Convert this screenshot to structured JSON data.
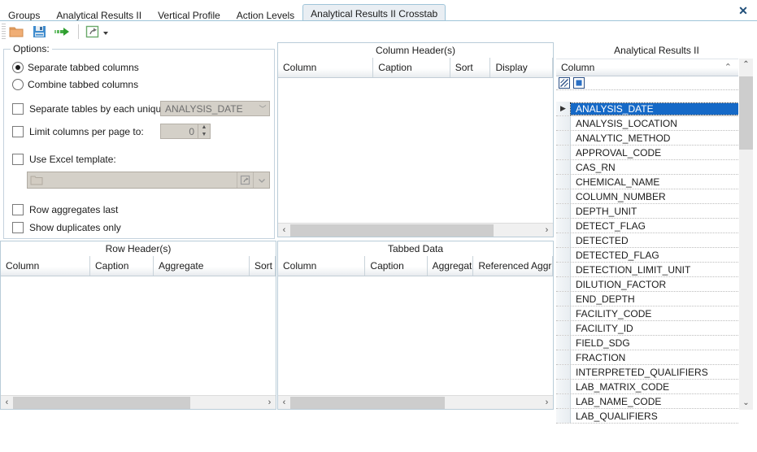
{
  "window": {
    "close_label": "✕"
  },
  "tabs": [
    {
      "label": "Groups",
      "active": false
    },
    {
      "label": "Analytical Results II",
      "active": false
    },
    {
      "label": "Vertical Profile",
      "active": false
    },
    {
      "label": "Action Levels",
      "active": false
    },
    {
      "label": "Analytical Results II Crosstab",
      "active": true
    }
  ],
  "toolbar": {
    "buttons": [
      {
        "name": "open-icon",
        "title": "Open"
      },
      {
        "name": "save-icon",
        "title": "Save"
      },
      {
        "name": "run-arrow-icon",
        "title": "Run"
      },
      {
        "name": "export-icon",
        "title": "Export"
      },
      {
        "name": "export-dropdown-icon",
        "title": "Export options"
      }
    ]
  },
  "options": {
    "group_title": "Options:",
    "radio_separate": "Separate tabbed columns",
    "radio_combine": "Combine tabbed columns",
    "radio_selected": "separate",
    "chk_separate_tables": "Separate tables by each unique:",
    "separate_tables_value": "ANALYSIS_DATE",
    "chk_limit_columns": "Limit columns per page to:",
    "limit_columns_value": "0",
    "chk_excel_template": "Use Excel template:",
    "excel_template_value": "",
    "chk_row_aggregates": "Row aggregates last",
    "chk_show_duplicates": "Show duplicates only"
  },
  "column_headers_panel": {
    "title": "Column Header(s)",
    "columns": [
      "Column",
      "Caption",
      "Sort",
      "Display"
    ],
    "rows": []
  },
  "row_headers_panel": {
    "title": "Row Header(s)",
    "columns": [
      "Column",
      "Caption",
      "Aggregate",
      "Sort"
    ],
    "rows": []
  },
  "tabbed_data_panel": {
    "title": "Tabbed Data",
    "columns": [
      "Column",
      "Caption",
      "Aggregate",
      "Referenced Aggre"
    ],
    "rows": []
  },
  "results_panel": {
    "title": "Analytical Results II",
    "column_header": "Column",
    "sort_indicator": "⌃",
    "filter_icons": [
      {
        "name": "clear-filter-icon"
      },
      {
        "name": "filter-stop-icon"
      }
    ],
    "selected_row": "ANALYSIS_DATE",
    "rows": [
      "ANALYSIS_DATE",
      "ANALYSIS_LOCATION",
      "ANALYTIC_METHOD",
      "APPROVAL_CODE",
      "CAS_RN",
      "CHEMICAL_NAME",
      "COLUMN_NUMBER",
      "DEPTH_UNIT",
      "DETECT_FLAG",
      "DETECTED",
      "DETECTED_FLAG",
      "DETECTION_LIMIT_UNIT",
      "DILUTION_FACTOR",
      "END_DEPTH",
      "FACILITY_CODE",
      "FACILITY_ID",
      "FIELD_SDG",
      "FRACTION",
      "INTERPRETED_QUALIFIERS",
      "LAB_MATRIX_CODE",
      "LAB_NAME_CODE",
      "LAB_QUALIFIERS"
    ],
    "scroll_up_icon": "⌃",
    "scroll_down_icon": "⌄"
  },
  "scrollbars": {
    "left_arrow": "‹",
    "right_arrow": "›"
  },
  "colors": {
    "selection": "#1569c7",
    "tab_active_bg": "#e9eef3",
    "tab_border": "#9fc4d8",
    "panel_border": "#b9ccd8",
    "close": "#1f4e79"
  }
}
